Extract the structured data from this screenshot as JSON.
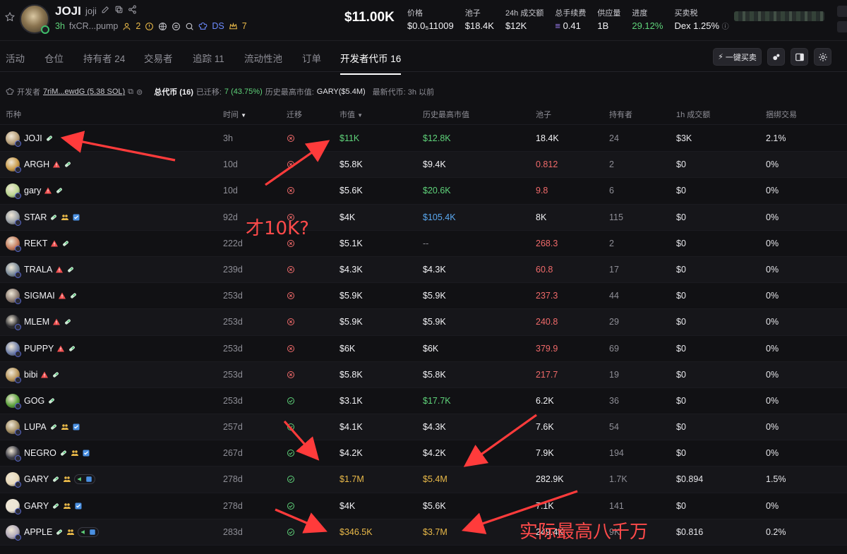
{
  "header": {
    "token_name": "JOJI",
    "token_ticker": "joji",
    "age": "3h",
    "address": "fxCR...pump",
    "holders_icon_count": "2",
    "ds_label": "DS",
    "crown_count": "7",
    "price_big": "$11.00K",
    "stats": [
      {
        "label": "价格",
        "value": "$0.0₅11009"
      },
      {
        "label": "池子",
        "value": "$18.4K"
      },
      {
        "label": "24h 成交额",
        "value": "$12K"
      },
      {
        "label": "总手续费",
        "value": "0.41"
      },
      {
        "label": "供应量",
        "value": "1B"
      },
      {
        "label": "进度",
        "value": "29.12%"
      },
      {
        "label": "买卖税",
        "value": "Dex 1.25%"
      }
    ]
  },
  "tabs": [
    "活动",
    "仓位",
    "持有者 24",
    "交易者",
    "追踪 11",
    "流动性池",
    "订单",
    "开发者代币 16"
  ],
  "active_tab": "开发者代币 16",
  "toolbar": {
    "buy_label": "一键买卖"
  },
  "devline": {
    "dev_label": "开发者",
    "dev_address": "7riM...ewdG (5.38 SOL)",
    "total_label": "总代币 (16)",
    "migrated_label": "已迁移:",
    "migrated_value": "7 (43.75%)",
    "ath_label": "历史最高市值:",
    "ath_value": "GARY($5.4M)",
    "latest_label": "最新代币: 3h 以前"
  },
  "columns": [
    "币种",
    "时间",
    "迁移",
    "市值",
    "历史最高市值",
    "池子",
    "持有者",
    "1h 成交额",
    "捆绑交易"
  ],
  "rows": [
    {
      "sym": "JOJI",
      "age": "3h",
      "mig": false,
      "mc": "$11K",
      "mc_c": "green",
      "ath": "$12.8K",
      "ath_c": "green",
      "pool": "18.4K",
      "pool_c": "white",
      "holders": "24",
      "vol": "$3K",
      "bundle": "2.1%",
      "av": "#b79e78",
      "warn": false,
      "extra": false,
      "tag": false
    },
    {
      "sym": "ARGH",
      "age": "10d",
      "mig": false,
      "mc": "$5.8K",
      "mc_c": "white",
      "ath": "$9.4K",
      "ath_c": "white",
      "pool": "0.812",
      "pool_c": "red",
      "holders": "2",
      "vol": "$0",
      "bundle": "0%",
      "av": "#c99a48",
      "warn": true,
      "extra": false,
      "tag": false
    },
    {
      "sym": "gary",
      "age": "10d",
      "mig": false,
      "mc": "$5.6K",
      "mc_c": "white",
      "ath": "$20.6K",
      "ath_c": "green",
      "pool": "9.8",
      "pool_c": "red",
      "holders": "6",
      "vol": "$0",
      "bundle": "0%",
      "av": "#b9d48f",
      "warn": true,
      "extra": false,
      "tag": false
    },
    {
      "sym": "STAR",
      "age": "92d",
      "mig": false,
      "mc": "$4K",
      "mc_c": "white",
      "ath": "$105.4K",
      "ath_c": "blue",
      "pool": "8K",
      "pool_c": "white",
      "holders": "115",
      "vol": "$0",
      "bundle": "0%",
      "av": "#9aa0a6",
      "warn": false,
      "extra": true,
      "tag": false
    },
    {
      "sym": "REKT",
      "age": "222d",
      "mig": false,
      "mc": "$5.1K",
      "mc_c": "white",
      "ath": "--",
      "ath_c": "grey",
      "pool": "268.3",
      "pool_c": "red",
      "holders": "2",
      "vol": "$0",
      "bundle": "0%",
      "av": "#c47a5a",
      "warn": true,
      "extra": false,
      "tag": false
    },
    {
      "sym": "TRALA",
      "age": "239d",
      "mig": false,
      "mc": "$4.3K",
      "mc_c": "white",
      "ath": "$4.3K",
      "ath_c": "white",
      "pool": "60.8",
      "pool_c": "red",
      "holders": "17",
      "vol": "$0",
      "bundle": "0%",
      "av": "#7a8a99",
      "warn": true,
      "extra": false,
      "tag": false
    },
    {
      "sym": "SIGMAI",
      "age": "253d",
      "mig": false,
      "mc": "$5.9K",
      "mc_c": "white",
      "ath": "$5.9K",
      "ath_c": "white",
      "pool": "237.3",
      "pool_c": "red",
      "holders": "44",
      "vol": "$0",
      "bundle": "0%",
      "av": "#8a7a70",
      "warn": true,
      "extra": false,
      "tag": false
    },
    {
      "sym": "MLEM",
      "age": "253d",
      "mig": false,
      "mc": "$5.9K",
      "mc_c": "white",
      "ath": "$5.9K",
      "ath_c": "white",
      "pool": "240.8",
      "pool_c": "red",
      "holders": "29",
      "vol": "$0",
      "bundle": "0%",
      "av": "#2a2a2e",
      "warn": true,
      "extra": false,
      "tag": false
    },
    {
      "sym": "PUPPY",
      "age": "253d",
      "mig": false,
      "mc": "$6K",
      "mc_c": "white",
      "ath": "$6K",
      "ath_c": "white",
      "pool": "379.9",
      "pool_c": "red",
      "holders": "69",
      "vol": "$0",
      "bundle": "0%",
      "av": "#6f7fa8",
      "warn": true,
      "extra": false,
      "tag": false
    },
    {
      "sym": "bibi",
      "age": "253d",
      "mig": false,
      "mc": "$5.8K",
      "mc_c": "white",
      "ath": "$5.8K",
      "ath_c": "white",
      "pool": "217.7",
      "pool_c": "red",
      "holders": "19",
      "vol": "$0",
      "bundle": "0%",
      "av": "#b8955a",
      "warn": true,
      "extra": false,
      "tag": false
    },
    {
      "sym": "GOG",
      "age": "253d",
      "mig": true,
      "mc": "$3.1K",
      "mc_c": "white",
      "ath": "$17.7K",
      "ath_c": "green",
      "pool": "6.2K",
      "pool_c": "white",
      "holders": "36",
      "vol": "$0",
      "bundle": "0%",
      "av": "#5aa03a",
      "warn": false,
      "extra": false,
      "tag": false
    },
    {
      "sym": "LUPA",
      "age": "257d",
      "mig": true,
      "mc": "$4.1K",
      "mc_c": "white",
      "ath": "$4.3K",
      "ath_c": "white",
      "pool": "7.6K",
      "pool_c": "white",
      "holders": "54",
      "vol": "$0",
      "bundle": "0%",
      "av": "#a08a60",
      "warn": false,
      "extra": true,
      "tag": false
    },
    {
      "sym": "NEGRO",
      "age": "267d",
      "mig": true,
      "mc": "$4.2K",
      "mc_c": "white",
      "ath": "$4.2K",
      "ath_c": "white",
      "pool": "7.9K",
      "pool_c": "white",
      "holders": "194",
      "vol": "$0",
      "bundle": "0%",
      "av": "#3a3a44",
      "warn": false,
      "extra": true,
      "tag": false
    },
    {
      "sym": "GARY",
      "age": "278d",
      "mig": true,
      "mc": "$1.7M",
      "mc_c": "gold",
      "ath": "$5.4M",
      "ath_c": "gold",
      "pool": "282.9K",
      "pool_c": "white",
      "holders": "1.7K",
      "vol": "$0.894",
      "bundle": "1.5%",
      "av": "#e8d8b8",
      "warn": false,
      "extra": true,
      "tag": true
    },
    {
      "sym": "GARY",
      "age": "278d",
      "mig": true,
      "mc": "$4K",
      "mc_c": "white",
      "ath": "$5.6K",
      "ath_c": "white",
      "pool": "7.1K",
      "pool_c": "white",
      "holders": "141",
      "vol": "$0",
      "bundle": "0%",
      "av": "#ece4d4",
      "warn": false,
      "extra": true,
      "tag": false
    },
    {
      "sym": "APPLE",
      "age": "283d",
      "mig": true,
      "mc": "$346.5K",
      "mc_c": "gold",
      "ath": "$3.7M",
      "ath_c": "gold",
      "pool": "249.4K",
      "pool_c": "white",
      "holders": "9K",
      "vol": "$0.816",
      "bundle": "0.2%",
      "av": "#b0a8b8",
      "warn": false,
      "extra": true,
      "tag": true
    }
  ],
  "annotations": {
    "note1": "才10K?",
    "note2": "实际最高八千万",
    "color": "#ff3b3b"
  }
}
